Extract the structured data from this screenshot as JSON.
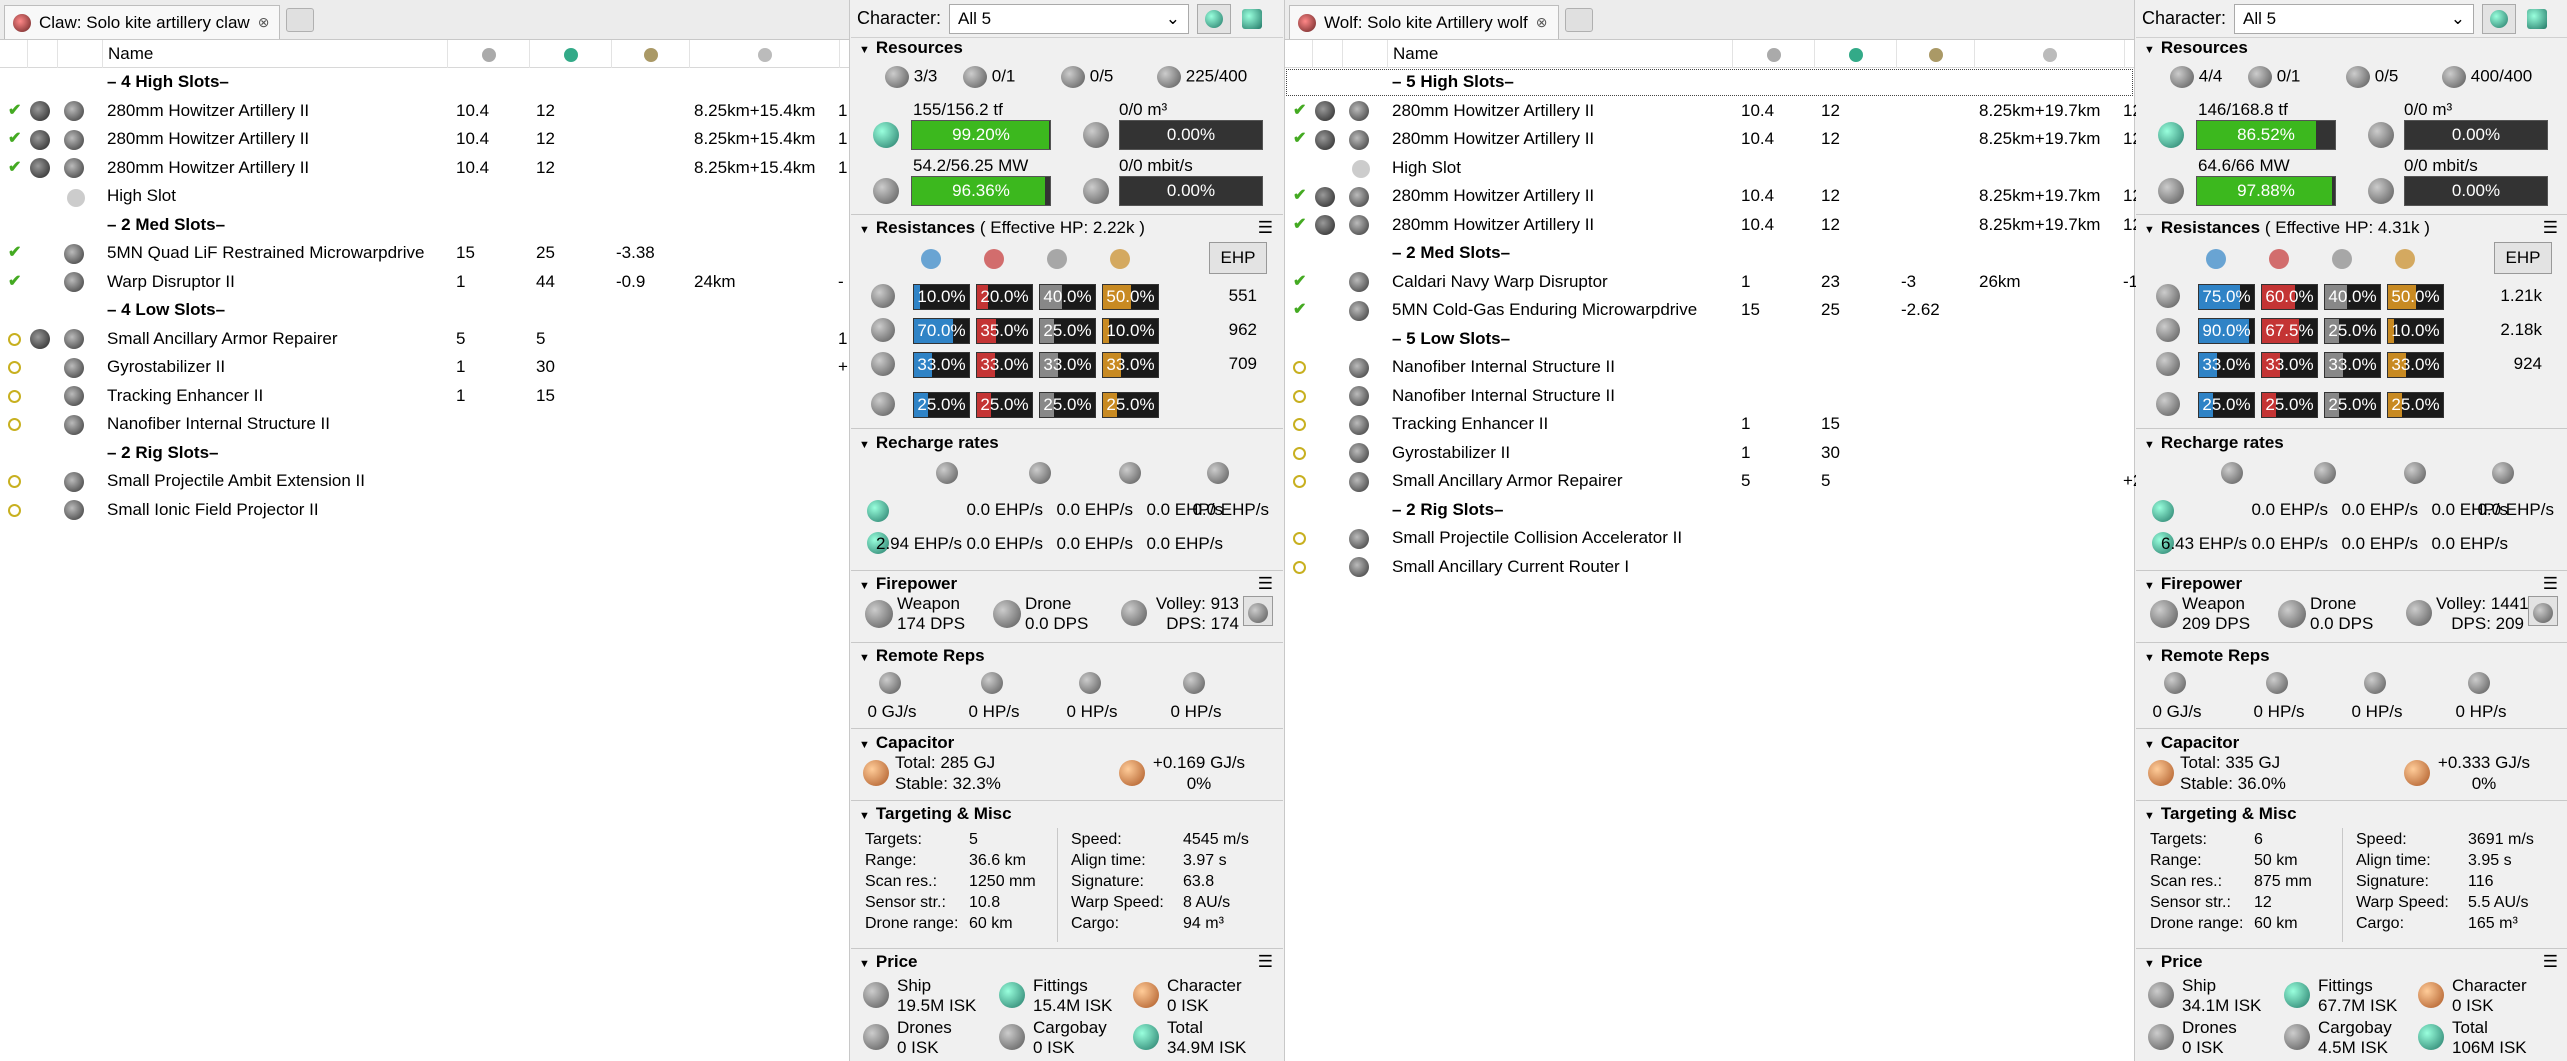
{
  "columns": {
    "name": "Name"
  },
  "left": {
    "tab_title": "Claw: Solo kite artillery claw",
    "character_label": "Character:",
    "character_value": "All 5",
    "rows": [
      {
        "sep": "– 4 High Slots–"
      },
      {
        "name": "280mm Howitzer Artillery II",
        "c1": "10.4",
        "c2": "12",
        "c3": "",
        "c4": "8.25km+15.4km",
        "c5": "1",
        "state": "check",
        "meta": true
      },
      {
        "name": "280mm Howitzer Artillery II",
        "c1": "10.4",
        "c2": "12",
        "c3": "",
        "c4": "8.25km+15.4km",
        "c5": "1",
        "state": "check",
        "meta": true
      },
      {
        "name": "280mm Howitzer Artillery II",
        "c1": "10.4",
        "c2": "12",
        "c3": "",
        "c4": "8.25km+15.4km",
        "c5": "1",
        "state": "check",
        "meta": true
      },
      {
        "name": "High Slot",
        "empty": true
      },
      {
        "sep": "– 2 Med Slots–"
      },
      {
        "name": "5MN Quad LiF Restrained Microwarpdrive",
        "c1": "15",
        "c2": "25",
        "c3": "-3.38",
        "c4": "",
        "c5": "",
        "state": "check"
      },
      {
        "name": "Warp Disruptor II",
        "c1": "1",
        "c2": "44",
        "c3": "-0.9",
        "c4": "24km",
        "c5": "-",
        "state": "check"
      },
      {
        "sep": "– 4 Low Slots–"
      },
      {
        "name": "Small Ancillary Armor Repairer",
        "c1": "5",
        "c2": "5",
        "c3": "",
        "c4": "",
        "c5": "1",
        "state": "dot",
        "meta": true
      },
      {
        "name": "Gyrostabilizer II",
        "c1": "1",
        "c2": "30",
        "c3": "",
        "c4": "",
        "c5": "+",
        "state": "dot"
      },
      {
        "name": "Tracking Enhancer II",
        "c1": "1",
        "c2": "15",
        "c3": "",
        "c4": "",
        "c5": "",
        "state": "dot"
      },
      {
        "name": "Nanofiber Internal Structure II",
        "c1": "",
        "c2": "",
        "c3": "",
        "c4": "",
        "c5": "",
        "state": "dot"
      },
      {
        "sep": "– 2 Rig Slots–"
      },
      {
        "name": "Small Projectile Ambit Extension II",
        "c1": "",
        "c2": "",
        "c3": "",
        "c4": "",
        "c5": "",
        "state": "dot"
      },
      {
        "name": "Small Ionic Field Projector II",
        "c1": "",
        "c2": "",
        "c3": "",
        "c4": "",
        "c5": "",
        "state": "dot"
      }
    ],
    "stats": {
      "resources_title": "Resources",
      "turrets": "3/3",
      "launchers": "0/1",
      "drone_bay": "0/5",
      "calibration": "225/400",
      "cpu_label": "155/156.2 tf",
      "cpu_pct": "99.20%",
      "cpu_fill": 0.992,
      "drone_bay_label": "0/0 m³",
      "drone_bay_pct": "0.00%",
      "pg_label": "54.2/56.25 MW",
      "pg_pct": "96.36%",
      "pg_fill": 0.9636,
      "bandwidth_label": "0/0 mbit/s",
      "bandwidth_pct": "0.00%",
      "resist_title": "Resistances",
      "resist_hp": "( Effective HP: 2.22k )",
      "ehp_button": "EHP",
      "resists": [
        {
          "v": [
            "10.0%",
            "20.0%",
            "40.0%",
            "50.0%"
          ],
          "f": [
            0.1,
            0.2,
            0.4,
            0.5
          ],
          "ehp": "551"
        },
        {
          "v": [
            "70.0%",
            "35.0%",
            "25.0%",
            "10.0%"
          ],
          "f": [
            0.7,
            0.35,
            0.25,
            0.1
          ],
          "ehp": "962"
        },
        {
          "v": [
            "33.0%",
            "33.0%",
            "33.0%",
            "33.0%"
          ],
          "f": [
            0.33,
            0.33,
            0.33,
            0.33
          ],
          "ehp": "709"
        },
        {
          "v": [
            "25.0%",
            "25.0%",
            "25.0%",
            "25.0%"
          ],
          "f": [
            0.25,
            0.25,
            0.25,
            0.25
          ],
          "ehp": ""
        }
      ],
      "recharge_title": "Recharge rates",
      "recharge_r1": [
        "0.0 EHP/s",
        "0.0 EHP/s",
        "0.0 EHP/s"
      ],
      "recharge_r2": [
        "2.94 EHP/s",
        "0.0 EHP/s",
        "0.0 EHP/s",
        "0.0 EHP/s"
      ],
      "firepower_title": "Firepower",
      "weapon_label": "Weapon",
      "weapon_dps": "174 DPS",
      "drone_label": "Drone",
      "drone_dps": "0.0 DPS",
      "volley": "Volley: 913",
      "dps": "DPS: 174",
      "remote_title": "Remote Reps",
      "remote": [
        "0 GJ/s",
        "0 HP/s",
        "0 HP/s",
        "0 HP/s"
      ],
      "cap_title": "Capacitor",
      "cap_total": "Total: 285 GJ",
      "cap_stable": "Stable: 32.3%",
      "cap_delta": "+0.169 GJ/s",
      "cap_delta_pct": "0%",
      "targ_title": "Targeting & Misc",
      "targ_left": [
        [
          "Targets:",
          "5"
        ],
        [
          "Range:",
          "36.6 km"
        ],
        [
          "Scan res.:",
          "1250 mm"
        ],
        [
          "Sensor str.:",
          "10.8"
        ],
        [
          "Drone range:",
          "60 km"
        ]
      ],
      "targ_right": [
        [
          "Speed:",
          "4545 m/s"
        ],
        [
          "Align time:",
          "3.97 s"
        ],
        [
          "Signature:",
          "63.8"
        ],
        [
          "Warp Speed:",
          "8 AU/s"
        ],
        [
          "Cargo:",
          "94 m³"
        ]
      ],
      "price_title": "Price",
      "price": [
        [
          "Ship",
          "19.5M ISK"
        ],
        [
          "Fittings",
          "15.4M ISK"
        ],
        [
          "Character",
          "0 ISK"
        ],
        [
          "Drones",
          "0 ISK"
        ],
        [
          "Cargobay",
          "0 ISK"
        ],
        [
          "Total",
          "34.9M ISK"
        ]
      ]
    }
  },
  "right": {
    "tab_title": "Wolf: Solo kite Artillery wolf",
    "character_label": "Character:",
    "character_value": "All 5",
    "rows": [
      {
        "sep": "– 5 High Slots–",
        "selected": true
      },
      {
        "name": "280mm Howitzer Artillery II",
        "c1": "10.4",
        "c2": "12",
        "c3": "",
        "c4": "8.25km+19.7km",
        "c5": "12",
        "state": "check",
        "meta": true
      },
      {
        "name": "280mm Howitzer Artillery II",
        "c1": "10.4",
        "c2": "12",
        "c3": "",
        "c4": "8.25km+19.7km",
        "c5": "12",
        "state": "check",
        "meta": true
      },
      {
        "name": "High Slot",
        "empty": true
      },
      {
        "name": "280mm Howitzer Artillery II",
        "c1": "10.4",
        "c2": "12",
        "c3": "",
        "c4": "8.25km+19.7km",
        "c5": "12",
        "state": "check",
        "meta": true
      },
      {
        "name": "280mm Howitzer Artillery II",
        "c1": "10.4",
        "c2": "12",
        "c3": "",
        "c4": "8.25km+19.7km",
        "c5": "12",
        "state": "check",
        "meta": true
      },
      {
        "sep": "– 2 Med Slots–"
      },
      {
        "name": "Caldari Navy Warp Disruptor",
        "c1": "1",
        "c2": "23",
        "c3": "-3",
        "c4": "26km",
        "c5": "-1",
        "state": "check"
      },
      {
        "name": "5MN Cold-Gas Enduring Microwarpdrive",
        "c1": "15",
        "c2": "25",
        "c3": "-2.62",
        "c4": "",
        "c5": "",
        "state": "check"
      },
      {
        "sep": "– 5 Low Slots–"
      },
      {
        "name": "Nanofiber Internal Structure II",
        "c1": "",
        "c2": "",
        "c3": "",
        "c4": "",
        "c5": "",
        "state": "dot"
      },
      {
        "name": "Nanofiber Internal Structure II",
        "c1": "",
        "c2": "",
        "c3": "",
        "c4": "",
        "c5": "",
        "state": "dot"
      },
      {
        "name": "Tracking Enhancer II",
        "c1": "1",
        "c2": "15",
        "c3": "",
        "c4": "",
        "c5": "",
        "state": "dot"
      },
      {
        "name": "Gyrostabilizer II",
        "c1": "1",
        "c2": "30",
        "c3": "",
        "c4": "",
        "c5": "",
        "state": "dot"
      },
      {
        "name": "Small Ancillary Armor Repairer",
        "c1": "5",
        "c2": "5",
        "c3": "",
        "c4": "",
        "c5": "+2",
        "state": "dot"
      },
      {
        "sep": "– 2 Rig Slots–"
      },
      {
        "name": "Small Projectile Collision Accelerator II",
        "c1": "",
        "c2": "",
        "c3": "",
        "c4": "",
        "c5": "",
        "state": "dot"
      },
      {
        "name": "Small Ancillary Current Router I",
        "c1": "",
        "c2": "",
        "c3": "",
        "c4": "",
        "c5": "",
        "state": "dot"
      }
    ],
    "stats": {
      "resources_title": "Resources",
      "turrets": "4/4",
      "launchers": "0/1",
      "drone_bay": "0/5",
      "calibration": "400/400",
      "cpu_label": "146/168.8 tf",
      "cpu_pct": "86.52%",
      "cpu_fill": 0.8652,
      "drone_bay_label": "0/0 m³",
      "drone_bay_pct": "0.00%",
      "pg_label": "64.6/66 MW",
      "pg_pct": "97.88%",
      "pg_fill": 0.9788,
      "bandwidth_label": "0/0 mbit/s",
      "bandwidth_pct": "0.00%",
      "resist_title": "Resistances",
      "resist_hp": "( Effective HP: 4.31k )",
      "ehp_button": "EHP",
      "resists": [
        {
          "v": [
            "75.0%",
            "60.0%",
            "40.0%",
            "50.0%"
          ],
          "f": [
            0.75,
            0.6,
            0.4,
            0.5
          ],
          "ehp": "1.21k"
        },
        {
          "v": [
            "90.0%",
            "67.5%",
            "25.0%",
            "10.0%"
          ],
          "f": [
            0.9,
            0.675,
            0.25,
            0.1
          ],
          "ehp": "2.18k"
        },
        {
          "v": [
            "33.0%",
            "33.0%",
            "33.0%",
            "33.0%"
          ],
          "f": [
            0.33,
            0.33,
            0.33,
            0.33
          ],
          "ehp": "924"
        },
        {
          "v": [
            "25.0%",
            "25.0%",
            "25.0%",
            "25.0%"
          ],
          "f": [
            0.25,
            0.25,
            0.25,
            0.25
          ],
          "ehp": ""
        }
      ],
      "recharge_title": "Recharge rates",
      "recharge_r1": [
        "0.0 EHP/s",
        "0.0 EHP/s",
        "0.0 EHP/s"
      ],
      "recharge_r2": [
        "6.43 EHP/s",
        "0.0 EHP/s",
        "0.0 EHP/s",
        "0.0 EHP/s"
      ],
      "firepower_title": "Firepower",
      "weapon_label": "Weapon",
      "weapon_dps": "209 DPS",
      "drone_label": "Drone",
      "drone_dps": "0.0 DPS",
      "volley": "Volley: 1441",
      "dps": "DPS: 209",
      "remote_title": "Remote Reps",
      "remote": [
        "0 GJ/s",
        "0 HP/s",
        "0 HP/s",
        "0 HP/s"
      ],
      "cap_title": "Capacitor",
      "cap_total": "Total: 335 GJ",
      "cap_stable": "Stable: 36.0%",
      "cap_delta": "+0.333 GJ/s",
      "cap_delta_pct": "0%",
      "targ_title": "Targeting & Misc",
      "targ_left": [
        [
          "Targets:",
          "6"
        ],
        [
          "Range:",
          "50 km"
        ],
        [
          "Scan res.:",
          "875 mm"
        ],
        [
          "Sensor str.:",
          "12"
        ],
        [
          "Drone range:",
          "60 km"
        ]
      ],
      "targ_right": [
        [
          "Speed:",
          "3691 m/s"
        ],
        [
          "Align time:",
          "3.95 s"
        ],
        [
          "Signature:",
          "116"
        ],
        [
          "Warp Speed:",
          "5.5 AU/s"
        ],
        [
          "Cargo:",
          "165 m³"
        ]
      ],
      "price_title": "Price",
      "price": [
        [
          "Ship",
          "34.1M ISK"
        ],
        [
          "Fittings",
          "67.7M ISK"
        ],
        [
          "Character",
          "0 ISK"
        ],
        [
          "Drones",
          "0 ISK"
        ],
        [
          "Cargobay",
          "4.5M ISK"
        ],
        [
          "Total",
          "106M ISK"
        ]
      ]
    }
  },
  "colors": {
    "cpu_green": "#3cb81e",
    "em": "#2f83c6",
    "thermal": "#c43434",
    "kinetic": "#888888",
    "explosive": "#c88a22"
  }
}
